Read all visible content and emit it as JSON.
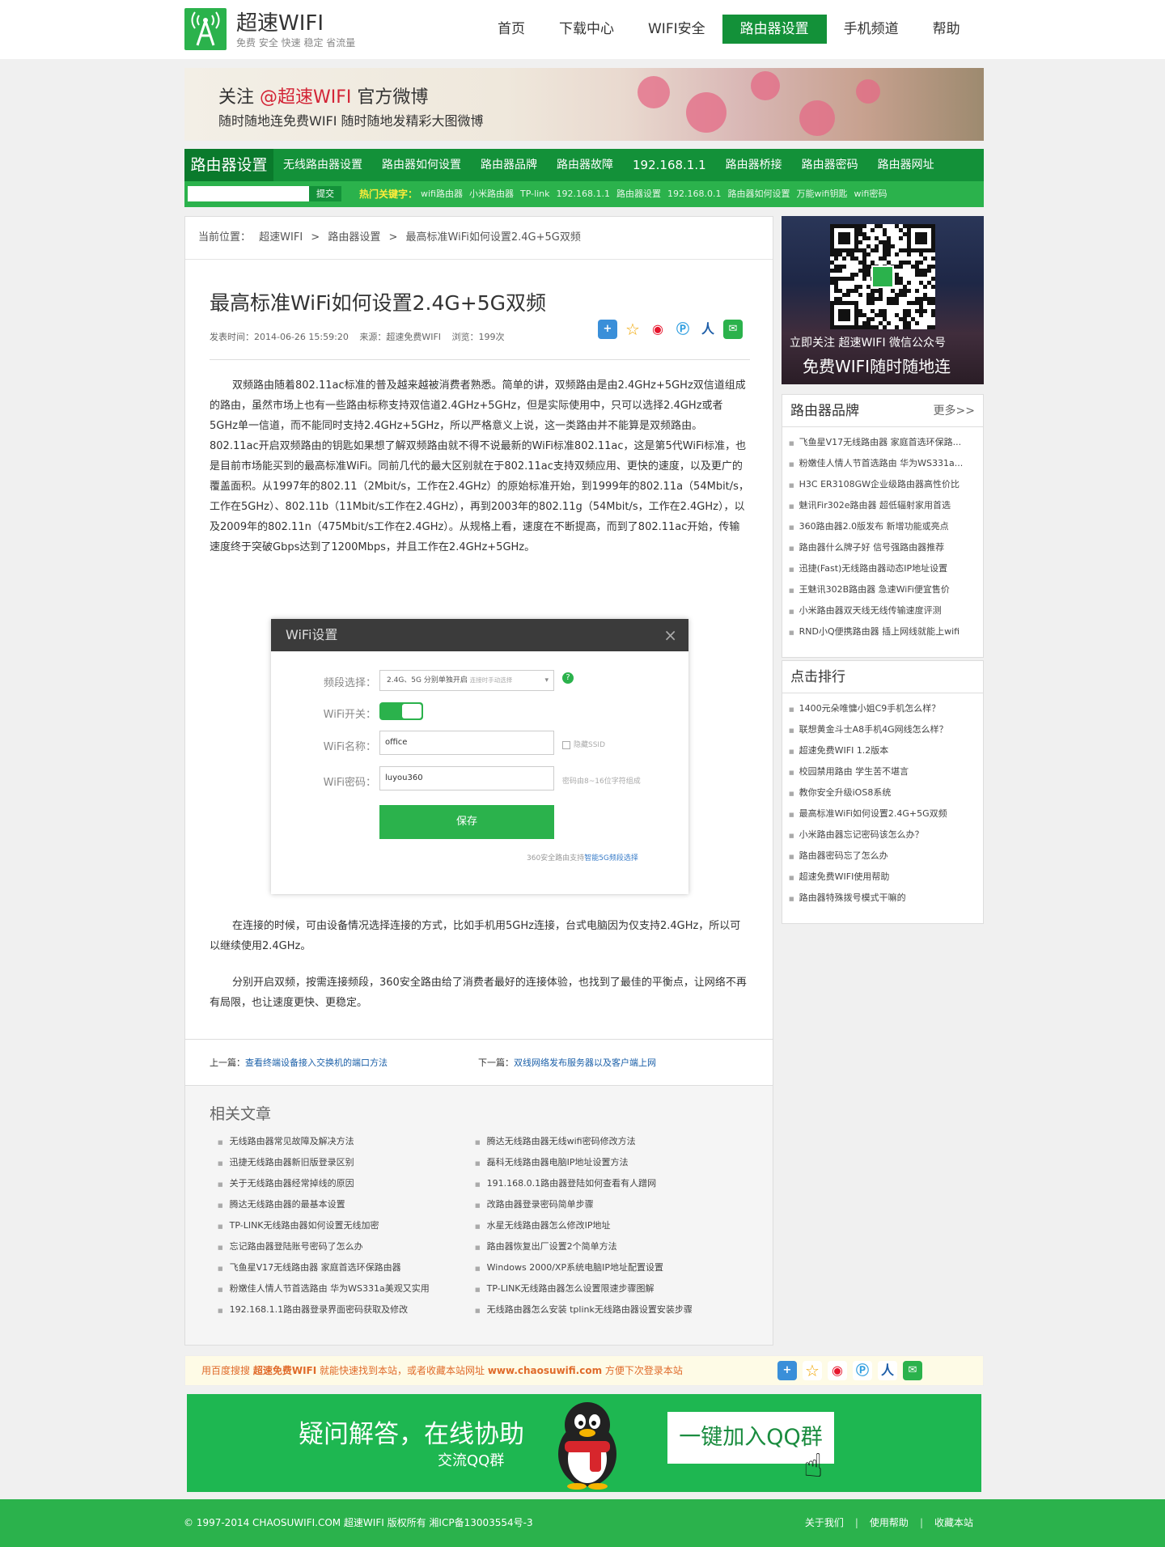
{
  "header": {
    "logo_name": "超速WIFI",
    "logo_slogan": "免费 安全 快速 稳定 省流量",
    "nav": [
      "首页",
      "下载中心",
      "WIFI安全",
      "路由器设置",
      "手机频道",
      "帮助"
    ],
    "active_nav": "路由器设置"
  },
  "banner": {
    "line1_pre": "关注 ",
    "line1_highlight": "@超速WIFI",
    "line1_post": " 官方微博",
    "line2": "随时随地连免费WIFI 随时随地发精彩大图微博"
  },
  "subnav": {
    "title": "路由器设置",
    "items": [
      "无线路由器设置",
      "路由器如何设置",
      "路由器品牌",
      "路由器故障",
      "192.168.1.1",
      "路由器桥接",
      "路由器密码",
      "路由器网址"
    ]
  },
  "search": {
    "placeholder": "",
    "button": "提交",
    "hot_label": "热门关键字：",
    "hot_items": [
      "wifi路由器",
      "小米路由器",
      "TP-link",
      "192.168.1.1",
      "路由器设置",
      "192.168.0.1",
      "路由器如何设置",
      "万能wifi钥匙",
      "wifi密码"
    ]
  },
  "breadcrumb": {
    "label": "当前位置：",
    "items": [
      "超速WIFI",
      ">",
      "路由器设置",
      ">",
      "最高标准WiFi如何设置2.4G+5G双频"
    ]
  },
  "article": {
    "title": "最高标准WiFi如何设置2.4G+5G双频",
    "meta_time": "发表时间：2014-06-26 15:59:20",
    "meta_source": "来源：超速免费WIFI",
    "meta_views": "浏览：199次",
    "p1": "双频路由随着802.11ac标准的普及越来越被消费者熟悉。简单的讲，双频路由是由2.4GHz+5GHz双信道组成的路由，虽然市场上也有一些路由标称支持双信道2.4GHz+5GHz，但是实际使用中，只可以选择2.4GHz或者5GHz单一信道，而不能同时支持2.4GHz+5GHz，所以严格意义上说，这一类路由并不能算是双频路由。",
    "p2": "802.11ac开启双频路由的钥匙如果想了解双频路由就不得不说最新的WiFi标准802.11ac，这是第5代WiFi标准，也是目前市场能买到的最高标准WiFi。同前几代的最大区别就在于802.11ac支持双频应用、更快的速度，以及更广的覆盖面积。从1997年的802.11（2Mbit/s，工作在2.4GHz）的原始标准开始，到1999年的802.11a（54Mbit/s，工作在5GHz）、802.11b（11Mbit/s工作在2.4GHz），再到2003年的802.11g（54Mbit/s，工作在2.4GHz），以及2009年的802.11n（475Mbit/s工作在2.4GHz）。从规格上看，速度在不断提高，而到了802.11ac开始，传输速度终于突破Gbps达到了1200Mbps，并且工作在2.4GHz+5GHz。",
    "p3": "在连接的时候，可由设备情况选择连接的方式，比如手机用5GHz连接，台式电脑因为仅支持2.4GHz，所以可以继续使用2.4GHz。",
    "p4": "分别开启双频，按需连接频段，360安全路由给了消费者最好的连接体验，也找到了最佳的平衡点，让网络不再有局限，也让速度更快、更稳定。"
  },
  "wifi_dialog": {
    "title": "WiFi设置",
    "close": "×",
    "band_label": "频段选择：",
    "band_value": "2.4G、5G 分别单独开启",
    "band_hint": "连接时手动选择",
    "help": "?",
    "switch_label": "WiFi开关：",
    "switch_state": true,
    "name_label": "WiFi名称：",
    "name_value": "office",
    "hide_ssid": "隐藏SSID",
    "pwd_label": "WiFi密码：",
    "pwd_value": "luyou360",
    "pwd_hint": "密码由8~16位字符组成",
    "save": "保存",
    "note_pre": "360安全路由支持",
    "note_link": "智能5G频段选择"
  },
  "prevnext": {
    "prev_label": "上一篇：",
    "prev": "查看终端设备接入交换机的端口方法",
    "next_label": "下一篇：",
    "next": "双线网络发布服务器以及客户端上网"
  },
  "related": {
    "title": "相关文章",
    "left": [
      "无线路由器常见故障及解决方法",
      "迅捷无线路由器新旧版登录区别",
      "关于无线路由器经常掉线的原因",
      "腾达无线路由器的最基本设置",
      "TP-LINK无线路由器如何设置无线加密",
      "忘记路由器登陆账号密码了怎么办",
      "飞鱼星V17无线路由器 家庭首选环保路由器",
      "粉嫩佳人情人节首选路由 华为WS331a美观又实用",
      "192.168.1.1路由器登录界面密码获取及修改"
    ],
    "right": [
      "腾达无线路由器无线wifi密码修改方法",
      "磊科无线路由器电脑IP地址设置方法",
      "191.168.0.1路由器登陆如何查看有人蹭网",
      "改路由器登录密码简单步骤",
      "水星无线路由器怎么修改IP地址",
      "路由器恢复出厂设置2个简单方法",
      "Windows 2000/XP系统电脑IP地址配置设置",
      "TP-LINK无线路由器怎么设置限速步骤图解",
      "无线路由器怎么安装 tplink无线路由器设置安装步骤"
    ]
  },
  "sidebar": {
    "qr_caption1": "立即关注 超速WIFI 微信公众号",
    "qr_caption2": "免费WIFI随时随地连",
    "brand_title": "路由器品牌",
    "brand_more": "更多>>",
    "brand_items": [
      "飞鱼星V17无线路由器 家庭首选环保路...",
      "粉嫩佳人情人节首选路由 华为WS331a...",
      "H3C ER3108GW企业级路由器高性价比",
      "魅讯Fir302e路由器 超低辐射家用首选",
      "360路由器2.0版发布 新增功能或亮点",
      "路由器什么牌子好 信号强路由器推荐",
      "迅捷(Fast)无线路由器动态IP地址设置",
      "王魅讯302B路由器 急速WiFi便宜售价",
      "小米路由器双天线无线传输速度评测",
      "RND小Q便携路由器 插上网线就能上wifi"
    ],
    "rank_title": "点击排行",
    "rank_items": [
      "1400元朵唯慵小姐C9手机怎么样？",
      "联想黄金斗士A8手机4G网线怎么样？",
      "超速免费WIFI 1.2版本",
      "校园禁用路由 学生苦不堪言",
      "教你安全升级iOS8系统",
      "最高标准WiFi如何设置2.4G+5G双频",
      "小米路由器忘记密码该怎么办？",
      "路由器密码忘了怎么办",
      "超速免费WIFI使用帮助",
      "路由器特殊拨号模式干嘛的"
    ]
  },
  "bookmark": {
    "pre": "用百度搜搜 ",
    "brand": "超速免费WIFI",
    "mid": " 就能快速找到本站，或者收藏本站网址 ",
    "url": "www.chaosuwifi.com",
    "post": " 方便下次登录本站"
  },
  "qq_banner": {
    "big": "疑问解答，在线协助",
    "small": "交流QQ群",
    "button": "一键加入QQ群"
  },
  "footer": {
    "copyright": "© 1997-2014 CHAOSUWIFI.COM 超速WIFI 版权所有 湘ICP备13003554号-3",
    "links": [
      "关于我们",
      "使用帮助",
      "收藏本站"
    ],
    "sep": "|"
  },
  "share_icons": [
    "share-plus-icon",
    "favorite-star-icon",
    "weibo-icon",
    "pengyou-icon",
    "renren-icon",
    "wechat-icon"
  ],
  "colors": {
    "brand_green": "#2bb24c",
    "dark_green": "#139139",
    "link_blue": "#1a5fa8"
  }
}
